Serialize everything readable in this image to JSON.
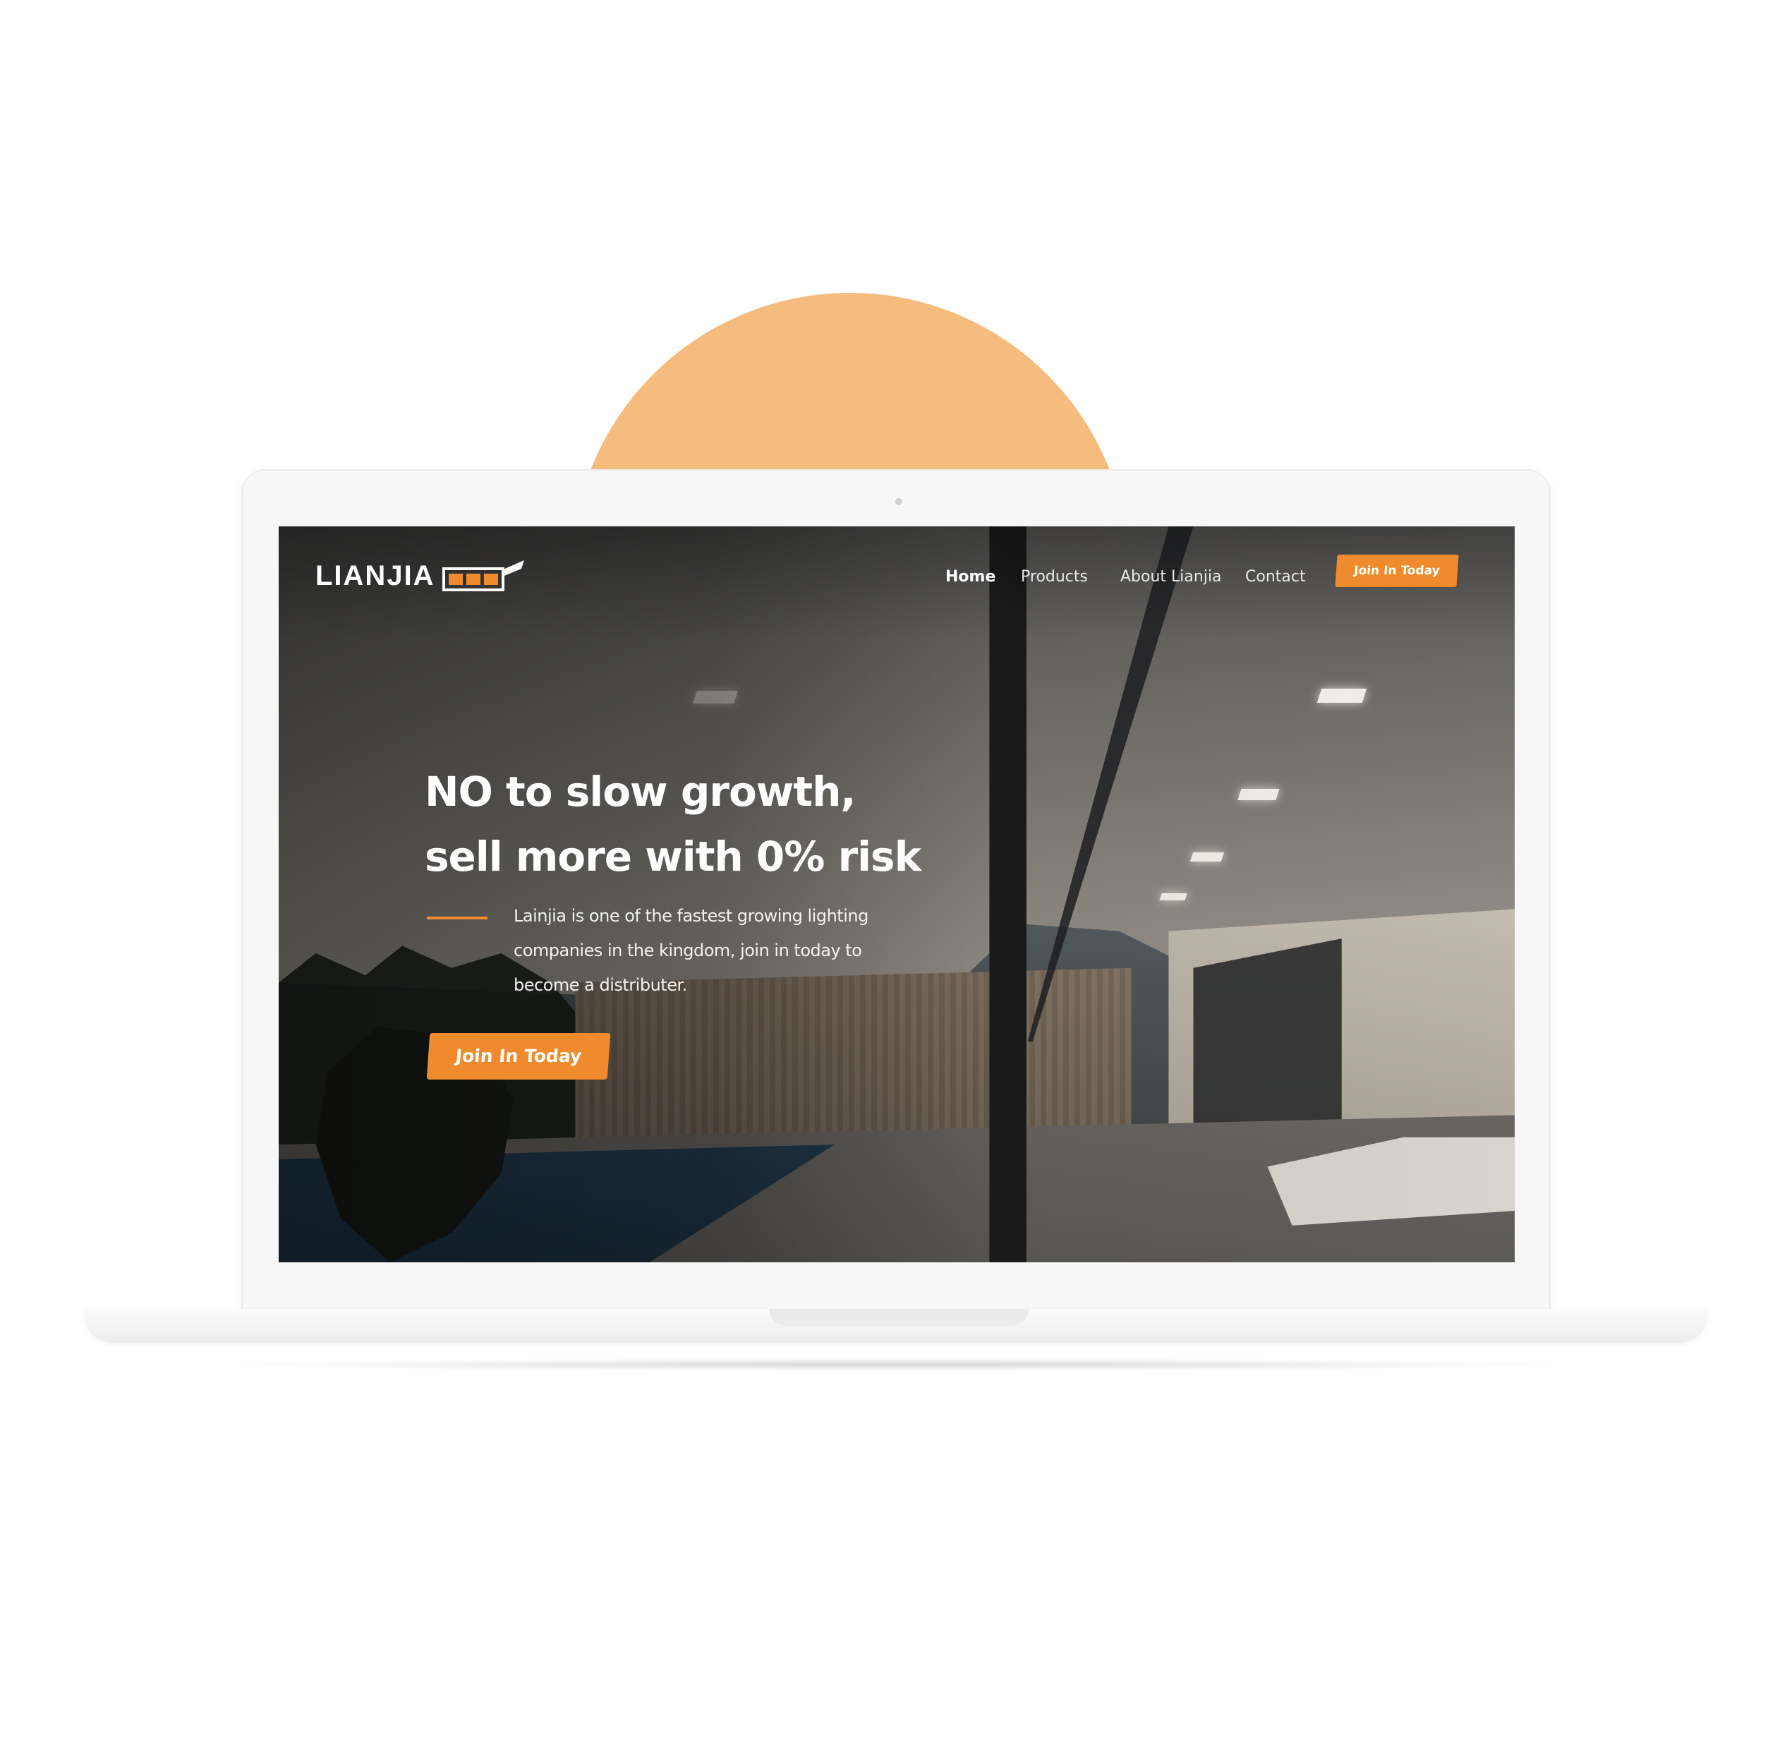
{
  "logo": {
    "name": "LIANJIA",
    "mark_icon": "led-logo-icon"
  },
  "nav": {
    "items": [
      {
        "label": "Home",
        "active": true
      },
      {
        "label": "Products",
        "active": false
      },
      {
        "label": "About Lianjia",
        "active": false
      },
      {
        "label": "Contact",
        "active": false
      }
    ],
    "cta_label": "Join In Today"
  },
  "hero": {
    "headline_line1": "NO to slow growth,",
    "headline_line2": "sell more with 0% risk",
    "sub_line1": "Lainjia is one of the fastest growing lighting",
    "sub_line2": "companies in the kingdom, join in today to",
    "sub_line3": "become a distributer.",
    "cta_label": "Join In Today"
  },
  "colors": {
    "accent": "#EF8B2C",
    "decor_circle": "#F5BC7E",
    "device": "#F7F7F7"
  }
}
